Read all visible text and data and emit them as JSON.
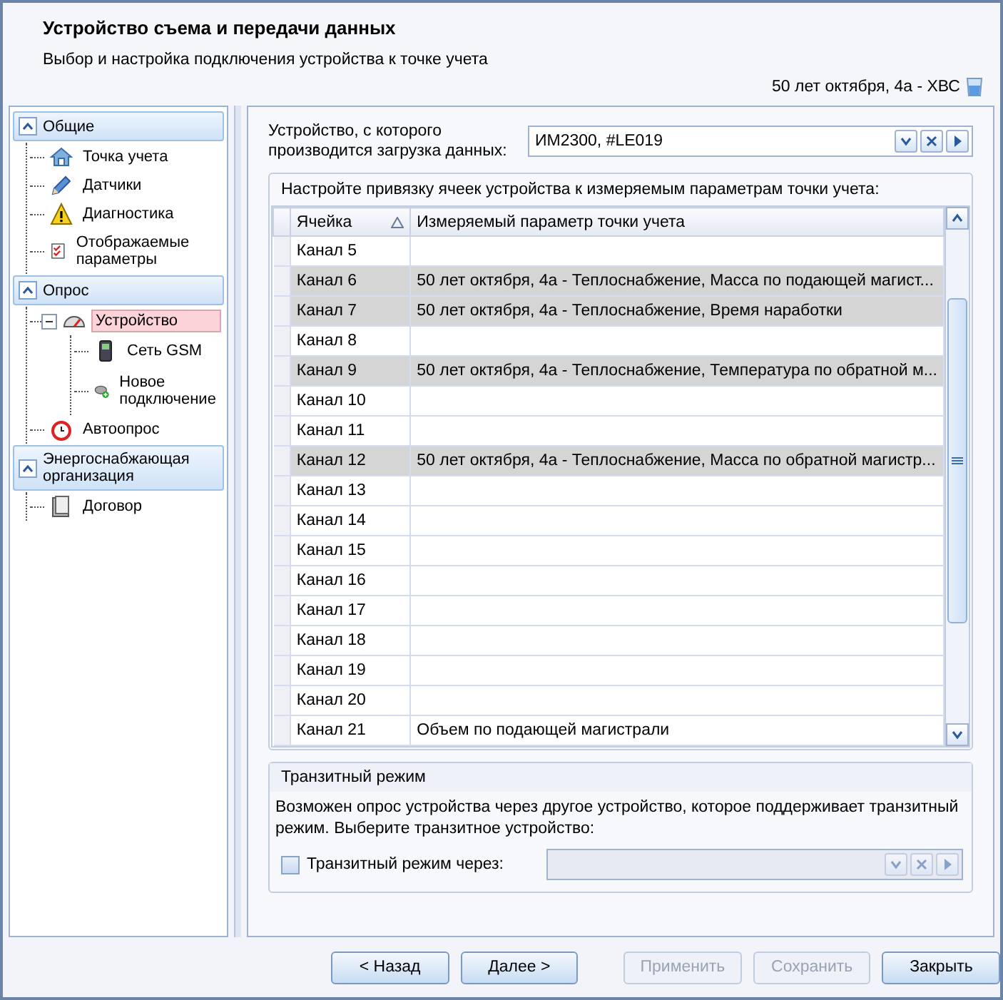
{
  "header": {
    "title": "Устройство съема и передачи данных",
    "subtitle": "Выбор и настройка подключения устройства к точке учета",
    "location": "50 лет октября, 4а - ХВС"
  },
  "nav": {
    "groups": [
      {
        "title": "Общие",
        "expanded": true,
        "items": [
          {
            "label": "Точка учета",
            "kind": "house",
            "selected": false
          },
          {
            "label": "Датчики",
            "kind": "pencil",
            "selected": false
          },
          {
            "label": "Диагностика",
            "kind": "warning",
            "selected": false
          },
          {
            "label": "Отображаемые параметры",
            "kind": "checklist",
            "selected": false
          }
        ]
      },
      {
        "title": "Опрос",
        "expanded": true,
        "items": [
          {
            "label": "Устройство",
            "kind": "gauge",
            "selected": true,
            "expanded": true,
            "children": [
              {
                "label": "Сеть GSM",
                "kind": "phone",
                "selected": false
              },
              {
                "label": "Новое подключение",
                "kind": "connection",
                "selected": false
              }
            ]
          },
          {
            "label": "Автоопрос",
            "kind": "clock",
            "selected": false
          }
        ]
      },
      {
        "title": "Энергоснабжающая организация",
        "expanded": true,
        "items": [
          {
            "label": "Договор",
            "kind": "document",
            "selected": false
          }
        ]
      }
    ]
  },
  "device": {
    "label": "Устройство, с которого производится загрузка данных:",
    "value": "ИМ2300, #LE019"
  },
  "grid": {
    "caption": "Настройте привязку ячеек устройства к измеряемым параметрам точки учета:",
    "columns": [
      {
        "label": "Ячейка",
        "sorted": true
      },
      {
        "label": "Измеряемый параметр точки учета",
        "sorted": false
      }
    ],
    "rows": [
      {
        "cell": "Канал 5",
        "parameter": "",
        "highlighted": false
      },
      {
        "cell": "Канал 6",
        "parameter": "50 лет октября, 4а - Теплоснабжение, Масса по подающей магист...",
        "highlighted": true
      },
      {
        "cell": "Канал 7",
        "parameter": "50 лет октября, 4а - Теплоснабжение, Время наработки",
        "highlighted": true
      },
      {
        "cell": "Канал 8",
        "parameter": "",
        "highlighted": false
      },
      {
        "cell": "Канал 9",
        "parameter": "50 лет октября, 4а - Теплоснабжение, Температура по обратной м...",
        "highlighted": true
      },
      {
        "cell": "Канал 10",
        "parameter": "",
        "highlighted": false
      },
      {
        "cell": "Канал 11",
        "parameter": "",
        "highlighted": false
      },
      {
        "cell": "Канал 12",
        "parameter": "50 лет октября, 4а - Теплоснабжение, Масса по обратной магистр...",
        "highlighted": true
      },
      {
        "cell": "Канал 13",
        "parameter": "",
        "highlighted": false
      },
      {
        "cell": "Канал 14",
        "parameter": "",
        "highlighted": false
      },
      {
        "cell": "Канал 15",
        "parameter": "",
        "highlighted": false
      },
      {
        "cell": "Канал 16",
        "parameter": "",
        "highlighted": false
      },
      {
        "cell": "Канал 17",
        "parameter": "",
        "highlighted": false
      },
      {
        "cell": "Канал 18",
        "parameter": "",
        "highlighted": false
      },
      {
        "cell": "Канал 19",
        "parameter": "",
        "highlighted": false
      },
      {
        "cell": "Канал 20",
        "parameter": "",
        "highlighted": false
      },
      {
        "cell": "Канал 21",
        "parameter": "Объем по подающей магистрали",
        "highlighted": false
      }
    ]
  },
  "transit": {
    "title": "Транзитный режим",
    "description": "Возможен опрос устройства через другое устройство, которое поддерживает транзитный режим. Выберите транзитное устройство:",
    "checkbox": {
      "label": "Транзитный режим через:",
      "checked": false
    },
    "combo_disabled": true
  },
  "buttons": [
    {
      "label": "< Назад",
      "disabled": false
    },
    {
      "label": "Далее >",
      "disabled": false
    },
    {
      "label": "Применить",
      "disabled": true
    },
    {
      "label": "Сохранить",
      "disabled": true
    },
    {
      "label": "Закрыть",
      "disabled": false
    }
  ]
}
